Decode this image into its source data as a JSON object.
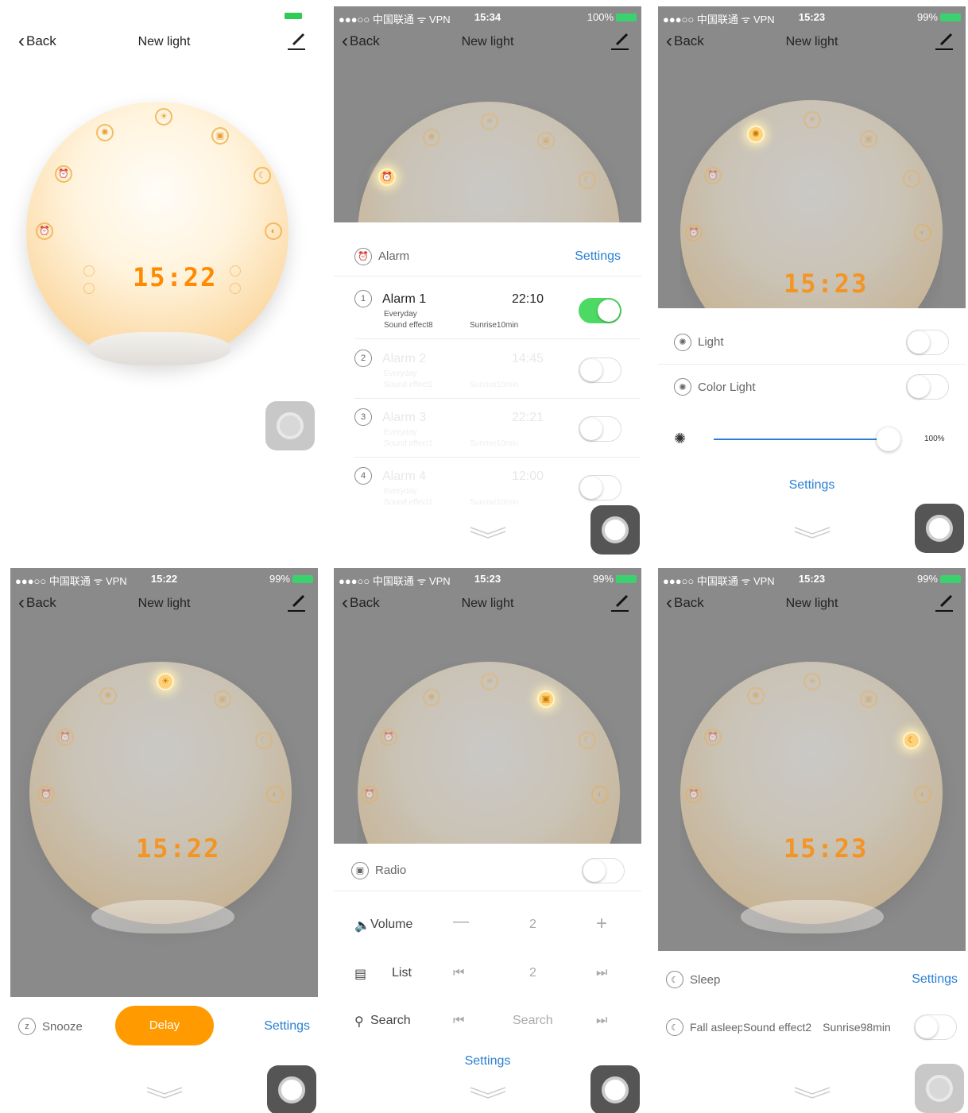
{
  "common": {
    "back_label": "Back",
    "title": "New light",
    "carrier": "●●●○○ 中国联通 ᯤ VPN"
  },
  "panel1": {
    "display_time": "15:22"
  },
  "panel2": {
    "status_time": "15:34",
    "battery": "100%",
    "section_label": "Alarm",
    "settings_label": "Settings",
    "alarms": [
      {
        "number": "1",
        "name": "Alarm 1",
        "time": "22:10",
        "repeat": "Everyday",
        "sound": "Sound effect8",
        "sunrise": "Sunrise10min",
        "enabled": true
      },
      {
        "number": "2",
        "name": "Alarm 2",
        "time": "14:45",
        "repeat": "Everyday",
        "sound": "Sound effect1",
        "sunrise": "Sunrise10min",
        "enabled": false
      },
      {
        "number": "3",
        "name": "Alarm 3",
        "time": "22:21",
        "repeat": "Everyday",
        "sound": "Sound effect1",
        "sunrise": "Sunrise10min",
        "enabled": false
      },
      {
        "number": "4",
        "name": "Alarm 4",
        "time": "12:00",
        "repeat": "Everyday",
        "sound": "Sound effect1",
        "sunrise": "Sunrise10min",
        "enabled": false
      }
    ]
  },
  "panel3": {
    "status_time": "15:23",
    "battery": "99%",
    "display_time": "15:23",
    "light_label": "Light",
    "color_light_label": "Color Light",
    "brightness_value": "100%",
    "brightness_fraction": 1.0,
    "settings_label": "Settings"
  },
  "panel4": {
    "status_time": "15:22",
    "battery": "99%",
    "display_time": "15:22",
    "snooze_label": "Snooze",
    "delay_label": "Delay",
    "settings_label": "Settings"
  },
  "panel5": {
    "status_time": "15:23",
    "battery": "99%",
    "radio_label": "Radio",
    "volume_label": "Volume",
    "volume_value": "2",
    "list_label": "List",
    "list_value": "2",
    "search_label": "Search",
    "search_value": "Search",
    "settings_label": "Settings"
  },
  "panel6": {
    "status_time": "15:23",
    "battery": "99%",
    "display_time": "15:23",
    "sleep_label": "Sleep",
    "settings_label": "Settings",
    "fall_asleep_label": "Fall asleep",
    "sound_label": "Sound effect2",
    "sunrise_label": "Sunrise98min"
  },
  "colors": {
    "accent_blue": "#2a7fd4",
    "toggle_on": "#4cd964",
    "delay_orange": "#ff9a00",
    "display_orange": "#ff8a00"
  }
}
